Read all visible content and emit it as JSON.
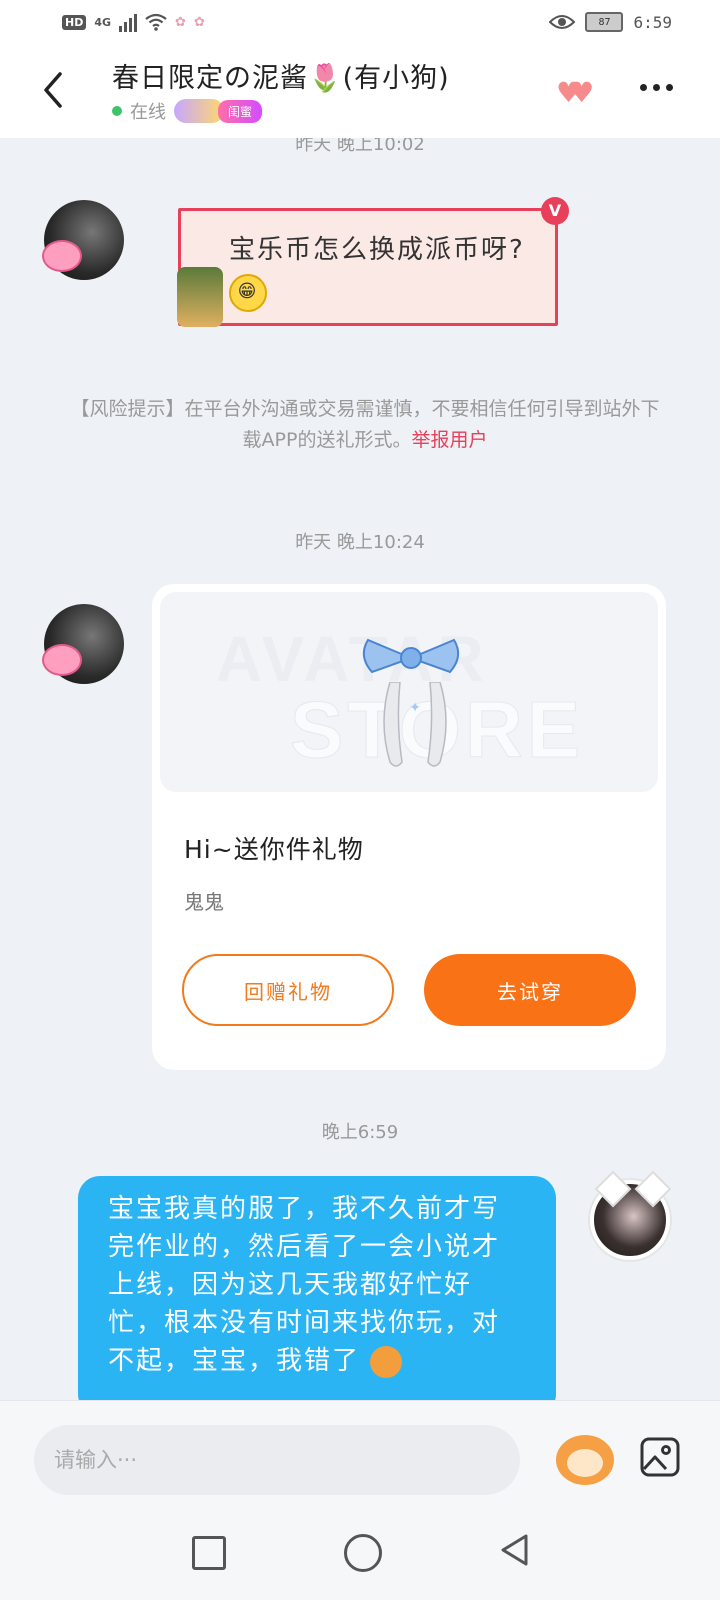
{
  "status_bar": {
    "network_label": "HD",
    "network_type": "4G",
    "battery": "87",
    "time": "6:59"
  },
  "header": {
    "title": "春日限定の泥酱🌷(有小狗)",
    "status": "在线",
    "relation_badge": "闺蜜"
  },
  "messages": {
    "ts1": "昨天 晚上10:02",
    "msg1": "宝乐币怎么换成派币呀?",
    "msg1_emoji": "😁",
    "risk_notice": "【风险提示】在平台外沟通或交易需谨慎，不要相信任何引导到站外下载APP的送礼形式。",
    "risk_report_link": "举报用户",
    "ts2": "昨天 晚上10:24",
    "gift": {
      "watermark_top": "AVATAR",
      "watermark_bottom": "STORE",
      "title": "Hi~送你件礼物",
      "sender": "鬼鬼",
      "return_label": "回赠礼物",
      "try_label": "去试穿"
    },
    "ts3": "晚上6:59",
    "msg2": "宝宝我真的服了，我不久前才写完作业的，然后看了一会小说才上线，因为这几天我都好忙好忙，根本没有时间来找你玩，对不起，宝宝，我错了"
  },
  "input": {
    "placeholder": "请输入···"
  },
  "icons": {
    "back": "chevron-left-icon",
    "hearts": "hearts-icon",
    "more": "more-dots-icon",
    "emoji": "emoji-icon",
    "image": "image-icon"
  },
  "colors": {
    "accent_orange": "#f97316",
    "my_bubble": "#2bb4f4",
    "report_red": "#e8405a",
    "online_green": "#3cc46b"
  }
}
